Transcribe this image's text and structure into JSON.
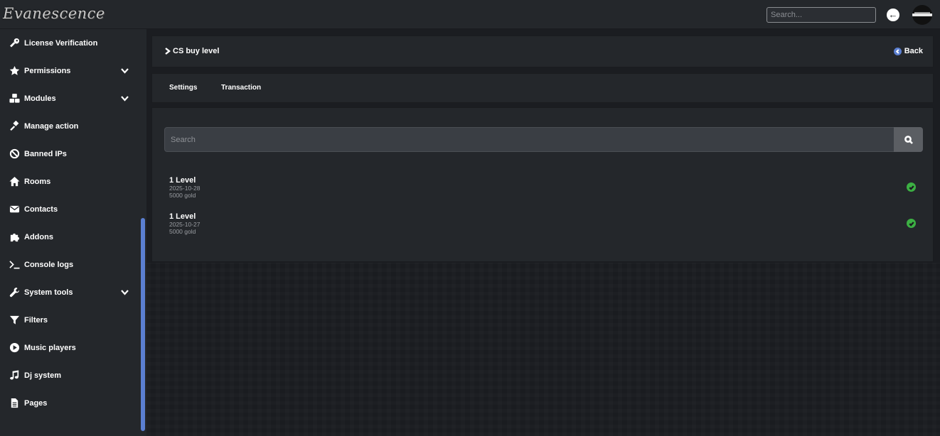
{
  "app": {
    "logo_text": "Evanescence"
  },
  "topbar": {
    "search_placeholder": "Search...",
    "back_icon": "arrow-left-circle-icon",
    "avatar_icon": "avatar"
  },
  "sidebar": {
    "items": [
      {
        "label": "License Verification",
        "icon": "key-icon",
        "expandable": false
      },
      {
        "label": "Permissions",
        "icon": "star-icon",
        "expandable": true
      },
      {
        "label": "Modules",
        "icon": "cubes-icon",
        "expandable": true
      },
      {
        "label": "Manage action",
        "icon": "gavel-icon",
        "expandable": false
      },
      {
        "label": "Banned IPs",
        "icon": "ban-icon",
        "expandable": false
      },
      {
        "label": "Rooms",
        "icon": "home-icon",
        "expandable": false
      },
      {
        "label": "Contacts",
        "icon": "envelope-icon",
        "expandable": false
      },
      {
        "label": "Addons",
        "icon": "puzzle-icon",
        "expandable": false
      },
      {
        "label": "Console logs",
        "icon": "terminal-icon",
        "expandable": false
      },
      {
        "label": "System tools",
        "icon": "wrench-icon",
        "expandable": true
      },
      {
        "label": "Filters",
        "icon": "filter-icon",
        "expandable": false
      },
      {
        "label": "Music players",
        "icon": "play-circle-icon",
        "expandable": false
      },
      {
        "label": "Dj system",
        "icon": "music-icon",
        "expandable": false
      },
      {
        "label": "Pages",
        "icon": "file-icon",
        "expandable": false
      }
    ]
  },
  "header": {
    "title": "CS buy level",
    "back_label": "Back"
  },
  "tabs": [
    {
      "label": "Settings"
    },
    {
      "label": "Transaction"
    }
  ],
  "content": {
    "search_placeholder": "Search",
    "transactions": [
      {
        "title": "1 Level",
        "date": "2025-10-28",
        "amount": "5000 gold",
        "status": "completed"
      },
      {
        "title": "1 Level",
        "date": "2025-10-27",
        "amount": "5000 gold",
        "status": "completed"
      }
    ]
  },
  "colors": {
    "accent": "#5b7fd1",
    "success": "#3cb043",
    "panel": "#24272b",
    "background": "#1b1d21"
  }
}
